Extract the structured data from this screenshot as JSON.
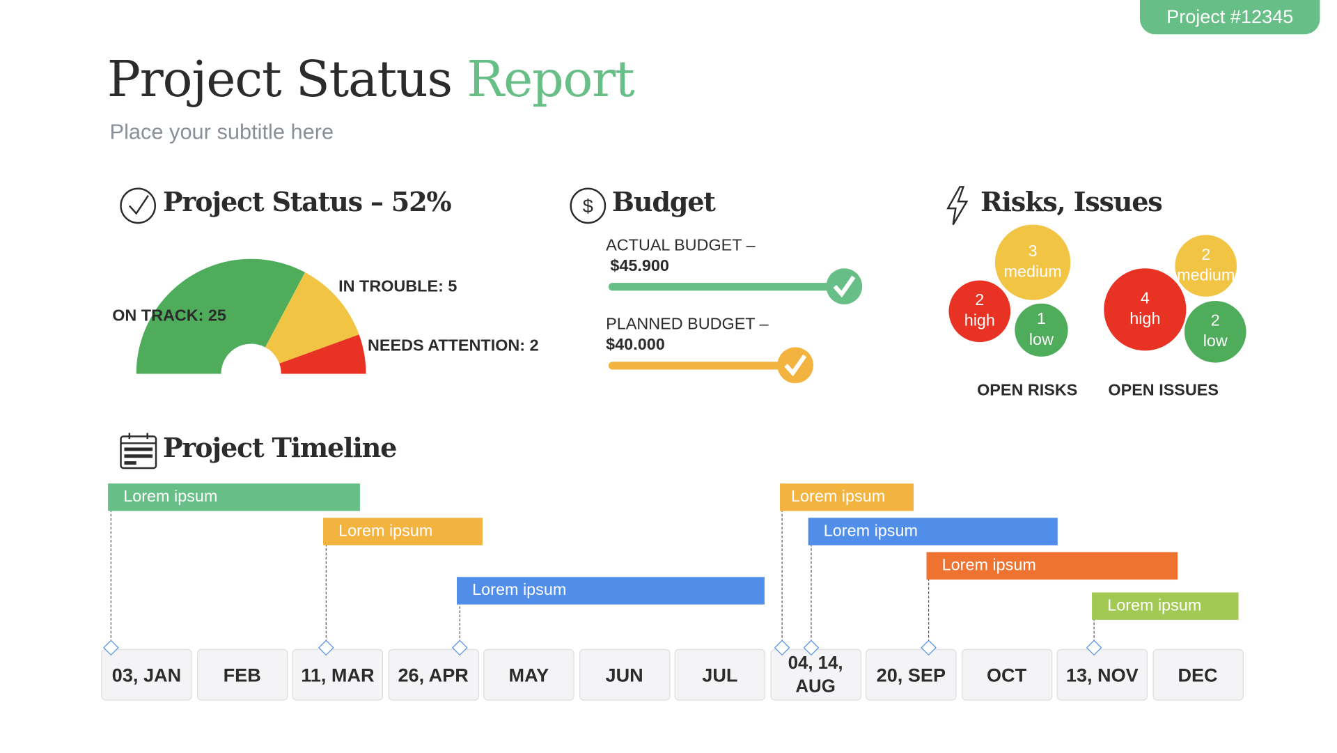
{
  "badge": "Project  #12345",
  "header": {
    "title_main": "Project Status ",
    "title_accent": "Report",
    "subtitle": "Place your subtitle here"
  },
  "status": {
    "heading": "Project Status – 52%",
    "percent": 52,
    "on_track": "ON TRACK: 25",
    "in_trouble": "IN TROUBLE: 5",
    "needs_attention": "NEEDS ATTENTION: 2",
    "segments": [
      {
        "value": 25,
        "color": "#4EAC5B"
      },
      {
        "value": 5,
        "color": "#F2C443"
      },
      {
        "value": 2,
        "color": "#E83324"
      }
    ]
  },
  "budget": {
    "heading": "Budget",
    "actual_label": "ACTUAL BUDGET –",
    "actual_value": "$45.900",
    "planned_label": "PLANNED BUDGET –",
    "planned_value": "$40.000",
    "actual_color": "#67BE86",
    "planned_color": "#F3B33F"
  },
  "risks": {
    "heading": "Risks, Issues",
    "open_risks_label": "OPEN RISKS",
    "open_issues_label": "OPEN ISSUES",
    "open_risks": [
      {
        "count": "3",
        "level": "medium"
      },
      {
        "count": "2",
        "level": "high"
      },
      {
        "count": "1",
        "level": "low"
      }
    ],
    "open_issues": [
      {
        "count": "4",
        "level": "high"
      },
      {
        "count": "2",
        "level": "medium"
      },
      {
        "count": "2",
        "level": "low"
      }
    ]
  },
  "timeline": {
    "heading": "Project Timeline",
    "tasks": [
      {
        "label": "Lorem ipsum",
        "color": "#67BE86"
      },
      {
        "label": "Lorem ipsum",
        "color": "#F3B33F"
      },
      {
        "label": "Lorem ipsum",
        "color": "#508EE9"
      },
      {
        "label": "Lorem ipsum",
        "color": "#F3B33F"
      },
      {
        "label": "Lorem ipsum",
        "color": "#508EE9"
      },
      {
        "label": "Lorem ipsum",
        "color": "#EE7330"
      },
      {
        "label": "Lorem ipsum",
        "color": "#A3C955"
      }
    ],
    "months": [
      "03, JAN",
      "FEB",
      "11, MAR",
      "26, APR",
      "MAY",
      "JUN",
      "JUL",
      "04, 14, AUG",
      "20, SEP",
      "OCT",
      "13, NOV",
      "DEC"
    ]
  }
}
